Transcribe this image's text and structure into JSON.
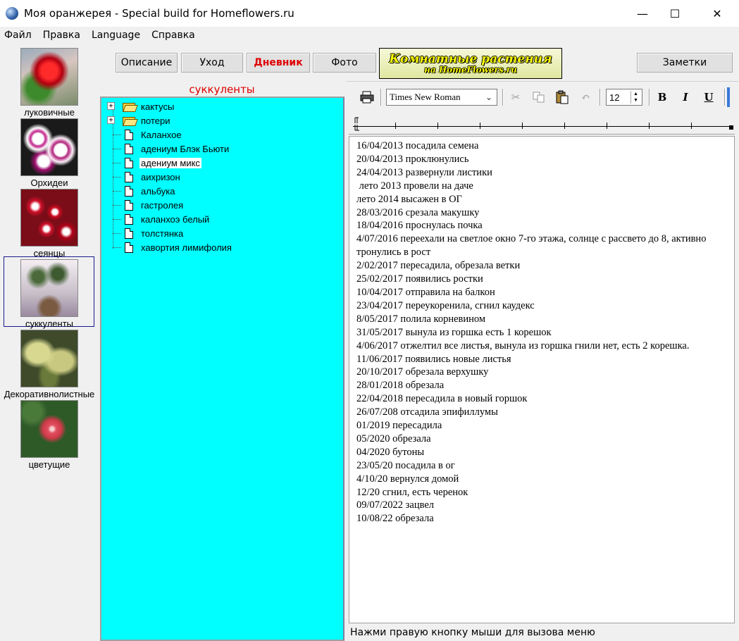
{
  "window": {
    "title": "Моя оранжерея - Special build for Homeflowers.ru",
    "minimize": "—",
    "maximize": "☐",
    "close": "✕"
  },
  "menu": [
    "Файл",
    "Правка",
    "Language",
    "Справка"
  ],
  "categories": [
    {
      "label": "луковичные",
      "icon": "red-amaryllis-photo"
    },
    {
      "label": "Орхидеи",
      "icon": "spotted-orchid-photo"
    },
    {
      "label": "сеянцы",
      "icon": "red-primrose-photo"
    },
    {
      "label": "суккуленты",
      "icon": "jade-plant-photo",
      "selected": true
    },
    {
      "label": "Декоративнолистные",
      "icon": "leafy-plant-photo"
    },
    {
      "label": "цветущие",
      "icon": "hibiscus-photo"
    }
  ],
  "tabs": {
    "description": "Описание",
    "care": "Уход",
    "diary": "Дневник",
    "photo": "Фото",
    "notes": "Заметки"
  },
  "logo": {
    "line1": "Комнатные растения",
    "line2": "на HomeFlowers.ru"
  },
  "tree": {
    "title": "суккуленты",
    "folders": [
      "кактусы",
      "потери"
    ],
    "items": [
      "Каланхое",
      "адениум Блэк Бьюти",
      "адениум микс",
      "аихризон",
      "альбука",
      "гастролея",
      "каланхоэ белый",
      "толстянка",
      "хавортия лимифолия"
    ],
    "selected": "адениум микс"
  },
  "editor": {
    "font": "Times New Roman",
    "size": "12",
    "bold": "B",
    "italic": "I",
    "underline": "U",
    "status": "Нажми правую кнопку мыши для вызова меню",
    "lines": [
      "16/04/2013 посадила семена",
      "20/04/2013 проклюнулись",
      "24/04/2013 развернули листики",
      " лето 2013 провели на даче",
      "лето 2014 высажен в ОГ",
      "28/03/2016 срезала макушку",
      "18/04/2016 проснулась почка",
      "4/07/2016 переехали на светлое окно 7-го этажа, солнце с рассвето до 8, активно тронулись в рост",
      "2/02/2017 пересадила, обрезала ветки",
      "25/02/2017 появились ростки",
      "10/04/2017 отправила на балкон",
      "23/04/2017 переукоренила, сгнил каудекс",
      "8/05/2017 полила корневином",
      "31/05/2017 вынула из горшка есть 1 корешок",
      "4/06/2017 отжелтил все листья, вынула из горшка гнили нет, есть 2 корешка.",
      "11/06/2017 появились новые листья",
      "20/10/2017 обрезала верхушку",
      "28/01/2018 обрезала",
      "22/04/2018 пересадила в новый горшок",
      "26/07/208 отсадила эпифиллумы",
      "01/2019 пересадила",
      "05/2020 обрезала",
      "04/2020 бутоны",
      "23/05/20 посадила в ог",
      "4/10/20 вернулся домой",
      "12/20 сгнил, есть черенок",
      "09/07/2022 зацвел",
      "10/08/22 обрезала"
    ]
  }
}
